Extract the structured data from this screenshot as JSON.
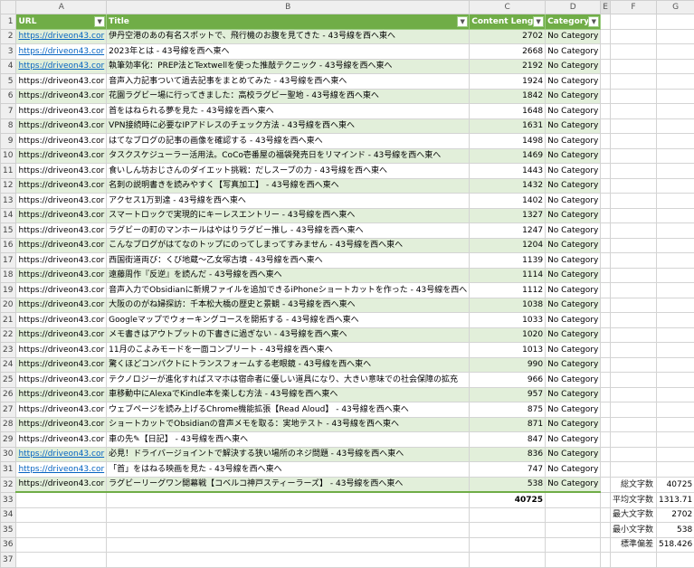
{
  "columns": [
    "A",
    "B",
    "C",
    "D",
    "E",
    "F",
    "G"
  ],
  "headers": {
    "url": "URL",
    "title": "Title",
    "length": "Content Length",
    "category": "Category"
  },
  "rows": [
    {
      "n": "2",
      "url": "https://driveon43.cor",
      "title": "伊丹空港のあの有名スポットで、飛行機のお腹を見てきた - 43号線を西へ東へ",
      "len": "2702",
      "cat": "No Category",
      "link": true
    },
    {
      "n": "3",
      "url": "https://driveon43.cor",
      "title": "2023年とは - 43号線を西へ東へ",
      "len": "2668",
      "cat": "No Category",
      "link": true
    },
    {
      "n": "4",
      "url": "https://driveon43.cor",
      "title": "執筆効率化：PREP法とTextwellを使った推敲テクニック - 43号線を西へ東へ",
      "len": "2192",
      "cat": "No Category",
      "link": true
    },
    {
      "n": "5",
      "url": "https://driveon43.cor",
      "title": "音声入力記事ついて過去記事をまとめてみた - 43号線を西へ東へ",
      "len": "1924",
      "cat": "No Category",
      "link": false
    },
    {
      "n": "6",
      "url": "https://driveon43.cor",
      "title": "花園ラグビー場に行ってきました：高校ラグビー聖地 - 43号線を西へ東へ",
      "len": "1842",
      "cat": "No Category",
      "link": false
    },
    {
      "n": "7",
      "url": "https://driveon43.cor",
      "title": "首をはねられる夢を見た - 43号線を西へ東へ",
      "len": "1648",
      "cat": "No Category",
      "link": false
    },
    {
      "n": "8",
      "url": "https://driveon43.cor",
      "title": "VPN接続時に必要なIPアドレスのチェック方法 - 43号線を西へ東へ",
      "len": "1631",
      "cat": "No Category",
      "link": false
    },
    {
      "n": "9",
      "url": "https://driveon43.cor",
      "title": "はてなブログの記事の画像を確認する - 43号線を西へ東へ",
      "len": "1498",
      "cat": "No Category",
      "link": false
    },
    {
      "n": "10",
      "url": "https://driveon43.cor",
      "title": "タスクスケジューラー活用法。CoCo壱番屋の福袋発売日をリマインド - 43号線を西へ東へ",
      "len": "1469",
      "cat": "No Category",
      "link": false
    },
    {
      "n": "11",
      "url": "https://driveon43.cor",
      "title": "食いしん坊おじさんのダイエット挑戦：だしスープの力 - 43号線を西へ東へ",
      "len": "1443",
      "cat": "No Category",
      "link": false
    },
    {
      "n": "12",
      "url": "https://driveon43.cor",
      "title": "名刺の説明書きを読みやすく【写真加工】 - 43号線を西へ東へ",
      "len": "1432",
      "cat": "No Category",
      "link": false
    },
    {
      "n": "13",
      "url": "https://driveon43.cor",
      "title": "アクセス1万到達 - 43号線を西へ東へ",
      "len": "1402",
      "cat": "No Category",
      "link": false
    },
    {
      "n": "14",
      "url": "https://driveon43.cor",
      "title": "スマートロックで実現的にキーレスエントリー - 43号線を西へ東へ",
      "len": "1327",
      "cat": "No Category",
      "link": false
    },
    {
      "n": "15",
      "url": "https://driveon43.cor",
      "title": "ラグビーの町のマンホールはやはりラグビー推し - 43号線を西へ東へ",
      "len": "1247",
      "cat": "No Category",
      "link": false
    },
    {
      "n": "16",
      "url": "https://driveon43.cor",
      "title": "こんなブログがはてなのトップにのってしまってすみません - 43号線を西へ東へ",
      "len": "1204",
      "cat": "No Category",
      "link": false
    },
    {
      "n": "17",
      "url": "https://driveon43.cor",
      "title": "西国街道両び：くび地蔵～乙女塚古墳 - 43号線を西へ東へ",
      "len": "1139",
      "cat": "No Category",
      "link": false
    },
    {
      "n": "18",
      "url": "https://driveon43.cor",
      "title": "遠藤周作『反逆』を読んだ - 43号線を西へ東へ",
      "len": "1114",
      "cat": "No Category",
      "link": false
    },
    {
      "n": "19",
      "url": "https://driveon43.cor",
      "title": "音声入力でObsidianに新規ファイルを追加できるiPhoneショートカットを作った - 43号線を西へ",
      "len": "1112",
      "cat": "No Category",
      "link": false
    },
    {
      "n": "20",
      "url": "https://driveon43.cor",
      "title": "大阪ののがね婦探訪：千本松大橋の歴史と景観 - 43号線を西へ東へ",
      "len": "1038",
      "cat": "No Category",
      "link": false
    },
    {
      "n": "21",
      "url": "https://driveon43.cor",
      "title": "Googleマップでウォーキングコースを開拓する - 43号線を西へ東へ",
      "len": "1033",
      "cat": "No Category",
      "link": false
    },
    {
      "n": "22",
      "url": "https://driveon43.cor",
      "title": "メモ書きはアウトプットの下書きに過ぎない - 43号線を西へ東へ",
      "len": "1020",
      "cat": "No Category",
      "link": false
    },
    {
      "n": "23",
      "url": "https://driveon43.cor",
      "title": "11月のこよみモードを一面コンプリート - 43号線を西へ東へ",
      "len": "1013",
      "cat": "No Category",
      "link": false
    },
    {
      "n": "24",
      "url": "https://driveon43.cor",
      "title": "驚くほどコンパクトにトランスフォームする老眼鏡 - 43号線を西へ東へ",
      "len": "990",
      "cat": "No Category",
      "link": false
    },
    {
      "n": "25",
      "url": "https://driveon43.cor",
      "title": "テクノロジーが進化すればスマホは宿命者に優しい道具になり、大きい意味での社会保障の拡充",
      "len": "966",
      "cat": "No Category",
      "link": false
    },
    {
      "n": "26",
      "url": "https://driveon43.cor",
      "title": "車移動中にAlexaでKindle本を楽しむ方法 - 43号線を西へ東へ",
      "len": "957",
      "cat": "No Category",
      "link": false
    },
    {
      "n": "27",
      "url": "https://driveon43.cor",
      "title": "ウェブページを読み上げるChrome機能拡張【Read Aloud】 - 43号線を西へ東へ",
      "len": "875",
      "cat": "No Category",
      "link": false
    },
    {
      "n": "28",
      "url": "https://driveon43.cor",
      "title": "ショートカットでObsidianの音声メモを取る：実地テスト - 43号線を西へ東へ",
      "len": "871",
      "cat": "No Category",
      "link": false
    },
    {
      "n": "29",
      "url": "https://driveon43.cor",
      "title": "車の先✎【日記】 - 43号線を西へ東へ",
      "len": "847",
      "cat": "No Category",
      "link": false
    },
    {
      "n": "30",
      "url": "https://driveon43.cor",
      "title": "必見！ドライバージョイントで解決する狭い場所のネジ問題 - 43号線を西へ東へ",
      "len": "836",
      "cat": "No Category",
      "link": true
    },
    {
      "n": "31",
      "url": "https://driveon43.cor",
      "title": "「首」をはねる映画を見た - 43号線を西へ東へ",
      "len": "747",
      "cat": "No Category",
      "link": true
    },
    {
      "n": "32",
      "url": "https://driveon43.cor",
      "title": "ラグビーリーグワン開幕戦【コベルコ神戸スティーラーズ】 - 43号線を西へ東へ",
      "len": "538",
      "cat": "No Category",
      "link": false
    }
  ],
  "total": {
    "n": "33",
    "value": "40725"
  },
  "empty_rows": [
    "34",
    "35",
    "36",
    "37"
  ],
  "stats": [
    {
      "label": "総文字数",
      "value": "40725"
    },
    {
      "label": "平均文字数",
      "value": "1313.71"
    },
    {
      "label": "最大文字数",
      "value": "2702"
    },
    {
      "label": "最小文字数",
      "value": "538"
    },
    {
      "label": "標準偏差",
      "value": "518.426"
    }
  ],
  "filter_icon": "filter-dropdown-icon"
}
